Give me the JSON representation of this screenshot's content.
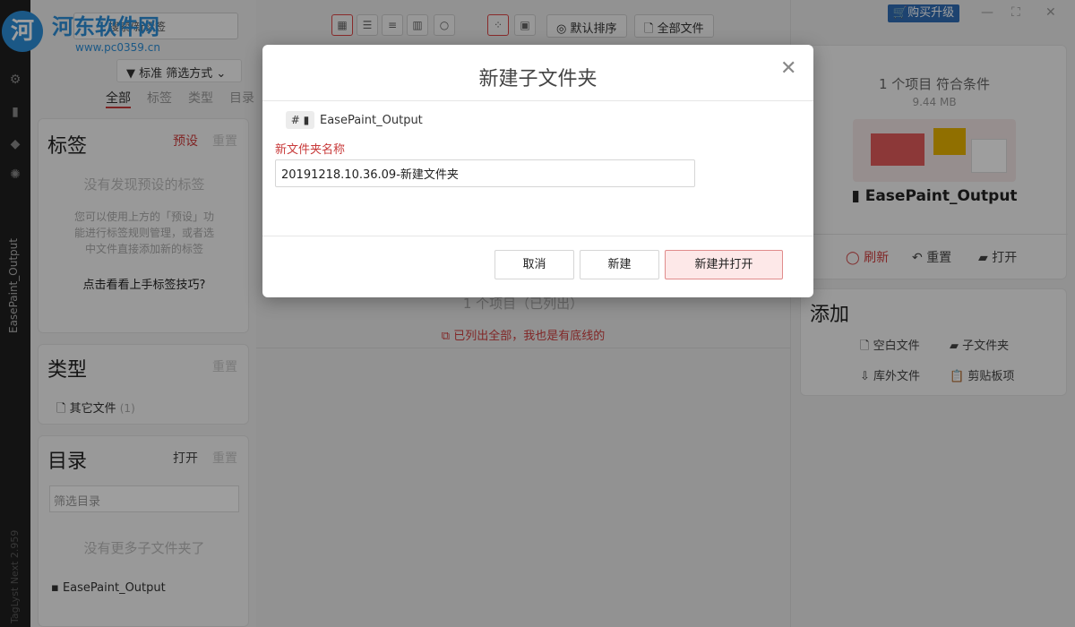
{
  "watermark": {
    "logo": "河",
    "line1": "河东软件网",
    "line2": "www.pc0359.cn"
  },
  "rail": {
    "vertical_label": "EasePaint_Output",
    "version": "TagLyst Next 2.959"
  },
  "left": {
    "search_placeholder": "搜索/新标签",
    "filter_mode": "标准 筛选方式",
    "tabs": [
      "全部",
      "标签",
      "类型",
      "目录"
    ],
    "tags_card": {
      "title": "标签",
      "preset": "预设",
      "reset": "重置",
      "empty": "没有发现预设的标签",
      "help": [
        "您可以使用上方的「预设」功",
        "能进行标签规则管理，或者选",
        "中文件直接添加新的标签"
      ],
      "tips": "点击看看上手标签技巧?"
    },
    "type_card": {
      "title": "类型",
      "reset": "重置",
      "item": "其它文件",
      "count": "(1)"
    },
    "dir_card": {
      "title": "目录",
      "open": "打开",
      "reset": "重置",
      "filter_placeholder": "筛选目录",
      "empty": "没有更多子文件夹了",
      "folder": "EasePaint_Output"
    }
  },
  "toolbar": {
    "sort": "默认排序",
    "all_files": "全部文件"
  },
  "middle": {
    "items_listed": "1 个项目（已列出）",
    "all_listed": "已列出全部，我也是有底线的"
  },
  "right": {
    "buy": "购买升级",
    "summary": "1 个项目 符合条件",
    "size": "9.44 MB",
    "folder_name": "EasePaint_Output",
    "actions": [
      "刷新",
      "重置",
      "打开"
    ],
    "add_title": "添加",
    "add_items": [
      "空白文件",
      "子文件夹",
      "库外文件",
      "剪贴板项"
    ]
  },
  "dialog": {
    "title": "新建子文件夹",
    "path_prefix": "#",
    "path": "EasePaint_Output",
    "field_label": "新文件夹名称",
    "field_value": "20191218.10.36.09-新建文件夹",
    "cancel": "取消",
    "create": "新建",
    "create_open": "新建并打开"
  },
  "colors": {
    "accent": "#c83a3a",
    "primary_bg": "#fde8e8",
    "buy": "#2f6db5",
    "rail": "#1f1f1f"
  }
}
